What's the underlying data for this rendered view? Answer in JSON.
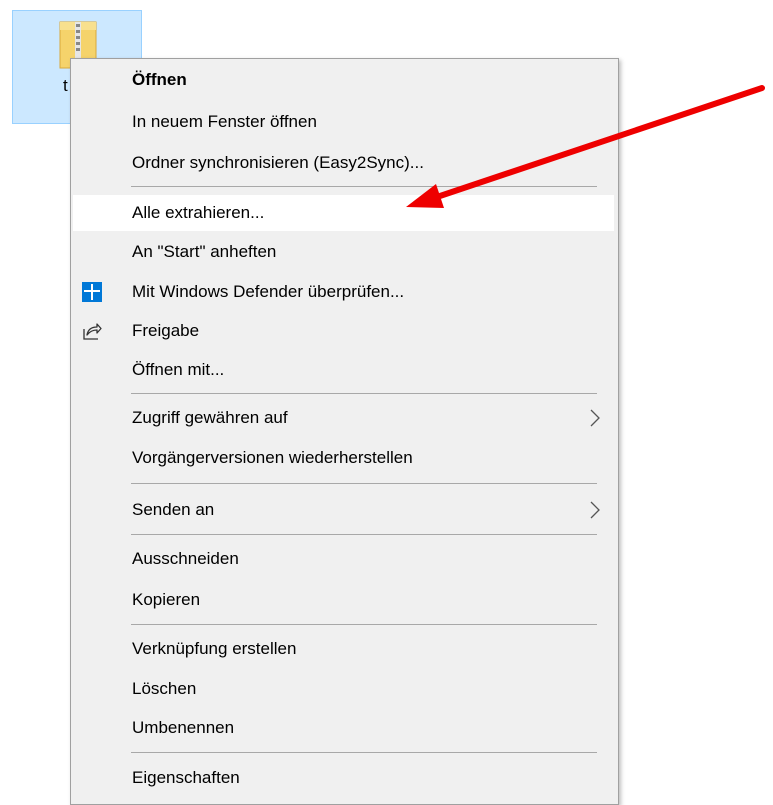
{
  "desktop": {
    "file_name": "t"
  },
  "context_menu": {
    "items": [
      {
        "label": "Öffnen"
      },
      {
        "label": "In neuem Fenster öffnen"
      },
      {
        "label": "Ordner synchronisieren (Easy2Sync)..."
      },
      {
        "label": "Alle extrahieren..."
      },
      {
        "label": "An \"Start\" anheften"
      },
      {
        "label": "Mit Windows Defender überprüfen...",
        "icon": "windows-defender-icon"
      },
      {
        "label": "Freigabe",
        "icon": "share-icon"
      },
      {
        "label": "Öffnen mit..."
      },
      {
        "label": "Zugriff gewähren auf",
        "submenu": true
      },
      {
        "label": "Vorgängerversionen wiederherstellen"
      },
      {
        "label": "Senden an",
        "submenu": true
      },
      {
        "label": "Ausschneiden"
      },
      {
        "label": "Kopieren"
      },
      {
        "label": "Verknüpfung erstellen"
      },
      {
        "label": "Löschen"
      },
      {
        "label": "Umbenennen"
      },
      {
        "label": "Eigenschaften"
      }
    ],
    "highlighted_item": "Alle extrahieren..."
  },
  "colors": {
    "menu_background": "#f0f0f0",
    "hover_background": "#ffffff",
    "selection_background": "#cce8ff",
    "annotation_arrow": "#ee0000",
    "defender_blue": "#0078d7"
  }
}
